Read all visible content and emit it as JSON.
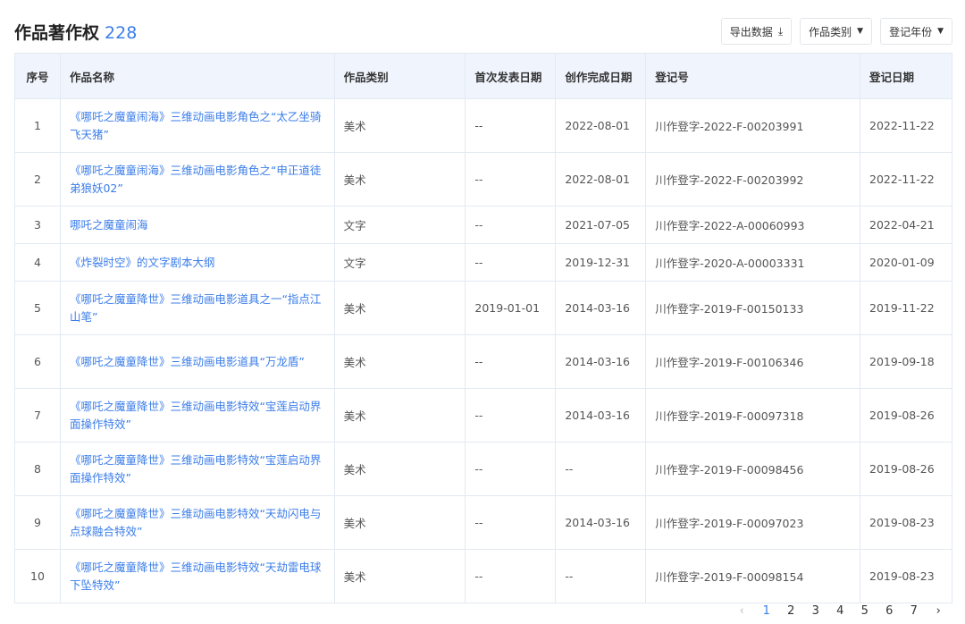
{
  "header": {
    "title": "作品著作权",
    "count": "228"
  },
  "toolbar": {
    "export": "导出数据",
    "category": "作品类别",
    "year": "登记年份"
  },
  "columns": [
    "序号",
    "作品名称",
    "作品类别",
    "首次发表日期",
    "创作完成日期",
    "登记号",
    "登记日期"
  ],
  "rows": [
    [
      "1",
      "《哪吒之魔童闹海》三维动画电影角色之“太乙坐骑飞天猪”",
      "美术",
      "--",
      "2022-08-01",
      "川作登字-2022-F-00203991",
      "2022-11-22"
    ],
    [
      "2",
      "《哪吒之魔童闹海》三维动画电影角色之“申正道徒弟狼妖02”",
      "美术",
      "--",
      "2022-08-01",
      "川作登字-2022-F-00203992",
      "2022-11-22"
    ],
    [
      "3",
      "哪吒之魔童闹海",
      "文字",
      "--",
      "2021-07-05",
      "川作登字-2022-A-00060993",
      "2022-04-21"
    ],
    [
      "4",
      "《炸裂时空》的文字剧本大纲",
      "文字",
      "--",
      "2019-12-31",
      "川作登字-2020-A-00003331",
      "2020-01-09"
    ],
    [
      "5",
      "《哪吒之魔童降世》三维动画电影道具之一“指点江山笔”",
      "美术",
      "2019-01-01",
      "2014-03-16",
      "川作登字-2019-F-00150133",
      "2019-11-22"
    ],
    [
      "6",
      "《哪吒之魔童降世》三维动画电影道具“万龙盾”",
      "美术",
      "--",
      "2014-03-16",
      "川作登字-2019-F-00106346",
      "2019-09-18"
    ],
    [
      "7",
      "《哪吒之魔童降世》三维动画电影特效“宝莲启动界面操作特效”",
      "美术",
      "--",
      "2014-03-16",
      "川作登字-2019-F-00097318",
      "2019-08-26"
    ],
    [
      "8",
      "《哪吒之魔童降世》三维动画电影特效“宝莲启动界面操作特效”",
      "美术",
      "--",
      "--",
      "川作登字-2019-F-00098456",
      "2019-08-26"
    ],
    [
      "9",
      "《哪吒之魔童降世》三维动画电影特效“天劫闪电与点球融合特效”",
      "美术",
      "--",
      "2014-03-16",
      "川作登字-2019-F-00097023",
      "2019-08-23"
    ],
    [
      "10",
      "《哪吒之魔童降世》三维动画电影特效“天劫雷电球下坠特效”",
      "美术",
      "--",
      "--",
      "川作登字-2019-F-00098154",
      "2019-08-23"
    ]
  ],
  "pagination": {
    "prev": "‹",
    "pages": [
      "1",
      "2",
      "3",
      "4",
      "5",
      "6",
      "7"
    ],
    "next": "›",
    "current": "1"
  }
}
